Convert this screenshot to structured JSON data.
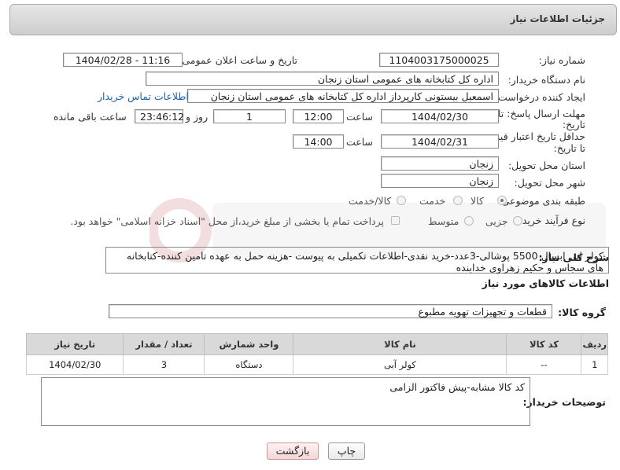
{
  "header": {
    "title": "جزئیات اطلاعات نیاز"
  },
  "fields": {
    "need_number": {
      "label": "شماره نیاز:",
      "value": "1104003175000025"
    },
    "announce": {
      "label": "تاریخ و ساعت اعلان عمومی:",
      "value": "1404/02/28 - 11:16"
    },
    "buyer": {
      "label": "نام دستگاه خریدار:",
      "value": "اداره کل کتابخانه های عمومی استان زنجان"
    },
    "creator": {
      "label": "ایجاد کننده درخواست:",
      "value": "اسمعیل بیستونی کارپرداز اداره کل کتابخانه های عمومی استان زنجان",
      "contact_link": "اطلاعات تماس خریدار"
    },
    "deadline": {
      "label1": "مهلت ارسال پاسخ: تا",
      "label2": "تاریخ:",
      "date": "1404/02/30",
      "time_label": "ساعت",
      "time": "12:00",
      "days": "1",
      "days_label": "روز و",
      "remaining": "23:46:12",
      "remaining_label": "ساعت باقی مانده"
    },
    "validity": {
      "label1": "حداقل تاریخ اعتبار قیمت:",
      "label2": "تا تاریخ:",
      "date": "1404/02/31",
      "time_label": "ساعت",
      "time": "14:00"
    },
    "province": {
      "label": "استان محل تحویل:",
      "value": "زنجان"
    },
    "city": {
      "label": "شهر محل تحویل:",
      "value": "زنجان"
    },
    "category": {
      "label": "طبقه بندی موضوعی:",
      "options": [
        "کالا",
        "خدمت",
        "کالا/خدمت"
      ],
      "selected": "کالا"
    },
    "process": {
      "label": "نوع فرآیند خرید :",
      "options": [
        "جزیی",
        "متوسط"
      ],
      "payment_note": "پرداخت تمام یا بخشی از مبلغ خرید،از محل \"اسناد خزانه اسلامی\" خواهد بود."
    }
  },
  "description": {
    "label": "شرح کلی نیاز:",
    "value": "کولر ابی ابسال 5500 پوشالی-3عدد-خرید نقدی-اطلاعات تکمیلی به پیوست -هزینه حمل به عهده تامین کننده-کتابخانه های سجاس و حکیم زهراوی خدابنده"
  },
  "goods_section": {
    "title": "اطلاعات کالاهای مورد نیاز"
  },
  "goods_group": {
    "label": "گروه کالا:",
    "value": "قطعات و تجهیزات تهویه مطبوع"
  },
  "table": {
    "headers": [
      "ردیف",
      "کد کالا",
      "نام کالا",
      "واحد شمارش",
      "تعداد / مقدار",
      "تاریخ نیاز"
    ],
    "rows": [
      [
        "1",
        "--",
        "کولر آبی",
        "دستگاه",
        "3",
        "1404/02/30"
      ]
    ]
  },
  "notes": {
    "label": "توضیحات خریدار:",
    "value": "کد کالا مشابه-پیش فاکتور الزامی"
  },
  "buttons": {
    "print": "چاپ",
    "back": "بازگشت"
  }
}
